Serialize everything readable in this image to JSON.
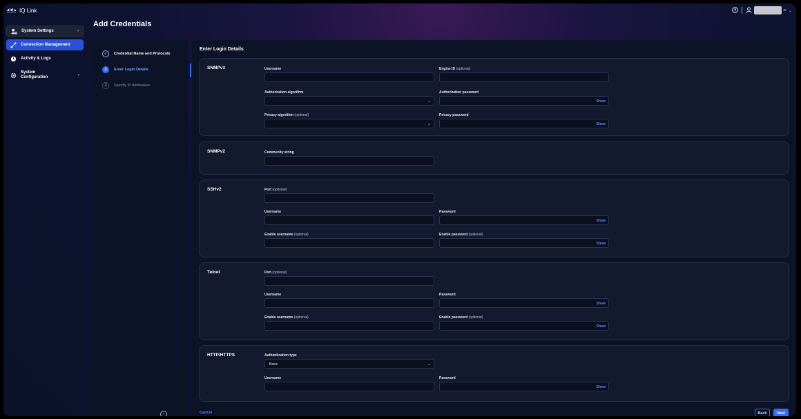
{
  "app": {
    "title": "IQ Link",
    "logo_icon": "cisco-logo-icon"
  },
  "header": {
    "help_icon": "help-icon",
    "user_icon": "user-icon",
    "user_suffix": "er"
  },
  "sidebar": {
    "items": [
      {
        "label": "System Settings",
        "icon": "system-settings-icon",
        "has_chevron": true
      },
      {
        "label": "Connection Management",
        "icon": "connection-icon",
        "active": true
      },
      {
        "label": "Activity & Logs",
        "icon": "activity-icon"
      },
      {
        "label": "System Configuration",
        "icon": "gear-icon",
        "has_chevron": true
      }
    ]
  },
  "page": {
    "title": "Add Credentials"
  },
  "steps": [
    {
      "number": "✓",
      "label": "Credential Name and Protocols",
      "state": "done"
    },
    {
      "number": "2",
      "label": "Enter Login Details",
      "state": "current"
    },
    {
      "number": "3",
      "label": "Specify IP Addresses",
      "state": "future"
    }
  ],
  "main": {
    "heading": "Enter Login Details",
    "optional": "(optional)",
    "show": "Show",
    "snmpv3": {
      "title": "SNMPv3",
      "username": "Username",
      "engine_id": "Engine ID",
      "auth_algorithm": "Authorization algorithm",
      "auth_password": "Authorization password",
      "privacy_algorithm": "Privacy algorithm",
      "privacy_password": "Privacy password"
    },
    "snmpv2": {
      "title": "SNMPv2",
      "community": "Community string"
    },
    "sshv2": {
      "title": "SSHv2",
      "port": "Port",
      "username": "Username",
      "password": "Password",
      "enable_username": "Enable username",
      "enable_password": "Enable password"
    },
    "telnet": {
      "title": "Telnet",
      "port": "Port",
      "username": "Username",
      "password": "Password",
      "enable_username": "Enable username",
      "enable_password": "Enable password"
    },
    "http": {
      "title": "HTTP/HTTPS",
      "auth_type": "Authentication type",
      "auth_type_value": "Basic",
      "username": "Username",
      "password": "Password"
    },
    "cancel": "Cancel",
    "back": "Back",
    "next": "Next"
  },
  "colors": {
    "accent": "#3b6df0",
    "link": "#5b8cff",
    "panel": "#0d1326",
    "card": "#131a2e"
  }
}
